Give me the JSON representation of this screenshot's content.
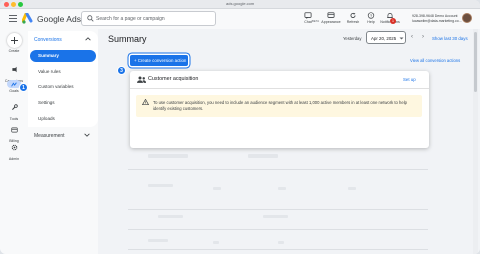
{
  "window": {
    "url": "ads.google.com"
  },
  "header": {
    "brand": "Google Ads",
    "search_placeholder": "Search for a page or campaign",
    "tools": [
      {
        "label": "Chat",
        "badge": "BETA"
      },
      {
        "label": "Appearance"
      },
      {
        "label": "Refresh"
      },
      {
        "label": "Help"
      },
      {
        "label": "Notifications",
        "count": "1"
      }
    ],
    "account_line1": "928-398-9648 Demo Account",
    "account_line2": "lucaswilm@data-marketing.co..."
  },
  "leftnav": {
    "items": [
      {
        "label": "Create"
      },
      {
        "label": "Campaigns"
      },
      {
        "label": "Goals"
      },
      {
        "label": "Tools"
      },
      {
        "label": "Billing"
      },
      {
        "label": "Admin"
      }
    ]
  },
  "subnav": {
    "group_title": "Conversions",
    "items": [
      {
        "label": "Summary"
      },
      {
        "label": "Value rules"
      },
      {
        "label": "Custom variables"
      },
      {
        "label": "Settings"
      },
      {
        "label": "Uploads"
      }
    ],
    "measurement": "Measurement"
  },
  "steps": {
    "one": "1",
    "two": "2",
    "three": "3"
  },
  "main": {
    "title": "Summary",
    "date_label": "Yesterday",
    "date_value": "Apr 20, 2025",
    "show_last": "Show last 30 days",
    "create_button": "+ Create conversion action",
    "view_all": "View all conversion actions",
    "card": {
      "title": "Customer acquisition",
      "setup": "Set up",
      "warning": "To use customer acquisition, you need to include an audience segment with at least 1,000 active members in at least one network to help identify existing customers."
    }
  }
}
